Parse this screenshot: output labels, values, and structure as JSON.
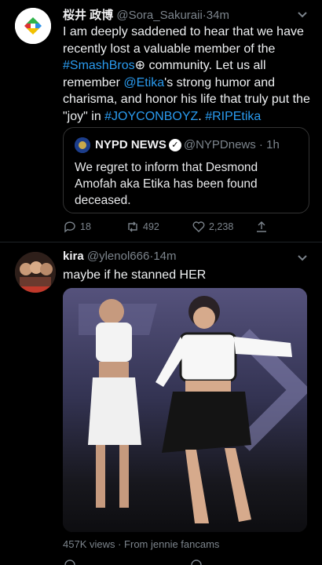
{
  "tweet1": {
    "display_name": "桜井 政博",
    "handle": "@Sora_Sakuraii",
    "time": "34m",
    "text_parts": [
      {
        "t": "I am deeply saddened to hear that we have recently lost a valuable member of the ",
        "link": false
      },
      {
        "t": "#SmashBros",
        "link": true
      },
      {
        "t": "⊕ community. Let us all remember ",
        "link": false
      },
      {
        "t": "@Etika",
        "link": true
      },
      {
        "t": "'s strong humor and charisma, and honor his life that truly put the \"joy\" in ",
        "link": false
      },
      {
        "t": "#JOYCONBOYZ",
        "link": true
      },
      {
        "t": ". ",
        "link": false
      },
      {
        "t": "#RIPEtika",
        "link": true
      }
    ],
    "quote": {
      "display_name": "NYPD NEWS",
      "handle": "@NYPDnews",
      "time": "1h",
      "text": "We regret to inform that Desmond Amofah aka Etika has been found deceased."
    },
    "replies": "18",
    "retweets": "492",
    "likes": "2,238"
  },
  "tweet2": {
    "display_name": "kira",
    "handle": "@ylenol666",
    "time": "14m",
    "text": "maybe if he stanned HER",
    "views": "457K views",
    "source": "From jennie fancams"
  },
  "colors": {
    "link": "#2a9bef",
    "muted": "#7c848c",
    "background": "#000000"
  }
}
